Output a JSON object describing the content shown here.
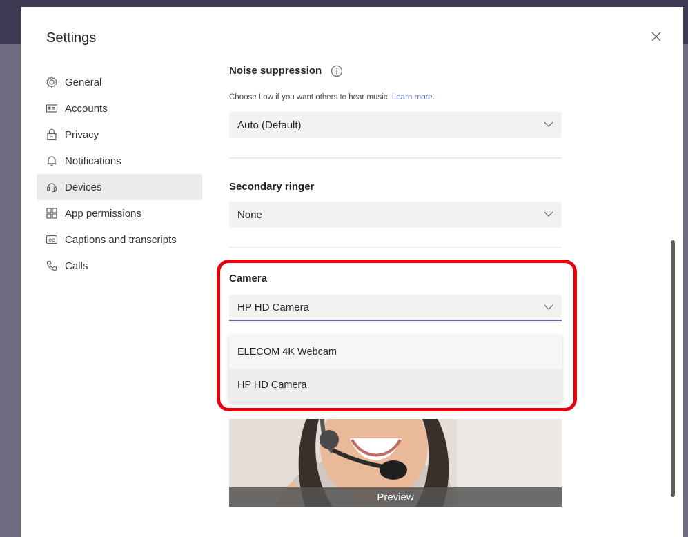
{
  "dialog": {
    "title": "Settings",
    "close_icon": "close-icon"
  },
  "nav": {
    "items": [
      {
        "label": "General",
        "icon": "gear-icon"
      },
      {
        "label": "Accounts",
        "icon": "id-card-icon"
      },
      {
        "label": "Privacy",
        "icon": "lock-icon"
      },
      {
        "label": "Notifications",
        "icon": "bell-icon"
      },
      {
        "label": "Devices",
        "icon": "devices-icon",
        "active": true
      },
      {
        "label": "App permissions",
        "icon": "apps-icon"
      },
      {
        "label": "Captions and transcripts",
        "icon": "captions-icon"
      },
      {
        "label": "Calls",
        "icon": "phone-icon"
      }
    ]
  },
  "noise": {
    "title": "Noise suppression",
    "hint": "Choose Low if you want others to hear music.",
    "link": "Learn more.",
    "value": "Auto (Default)"
  },
  "ringer": {
    "title": "Secondary ringer",
    "value": "None"
  },
  "camera": {
    "title": "Camera",
    "value": "HP HD Camera",
    "options": [
      "ELECOM 4K Webcam",
      "HP HD Camera"
    ],
    "selected_option": "HP HD Camera"
  },
  "preview": {
    "label": "Preview"
  },
  "colors": {
    "accent": "#6264a7",
    "highlight": "#e8000b",
    "link": "#4f52b2"
  }
}
